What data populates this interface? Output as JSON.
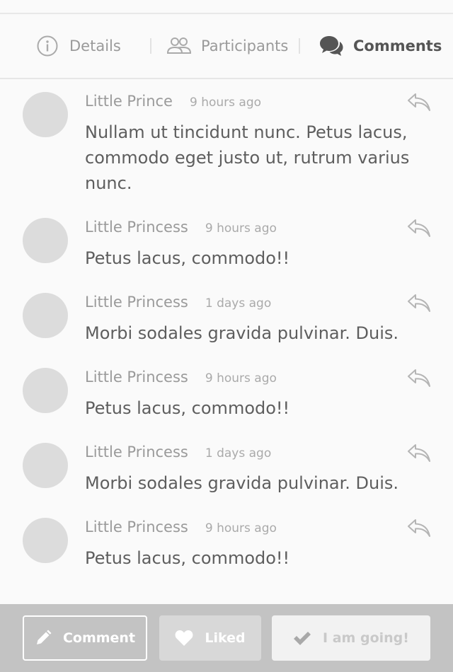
{
  "tabs": [
    {
      "label": "Details",
      "icon": "info-icon",
      "active": false
    },
    {
      "label": "Participants",
      "icon": "people-icon",
      "active": false
    },
    {
      "label": "Comments",
      "icon": "comments-icon",
      "active": true
    }
  ],
  "comments": [
    {
      "author": "Little Prince",
      "time": "9 hours ago",
      "text": "Nullam ut tincidunt nunc. Petus lacus, commodo eget justo ut, rutrum varius nunc."
    },
    {
      "author": "Little Princess",
      "time": "9 hours ago",
      "text": "Petus lacus, commodo!!"
    },
    {
      "author": "Little Princess",
      "time": "1 days ago",
      "text": "Morbi sodales gravida pulvinar. Duis."
    },
    {
      "author": "Little Princess",
      "time": "9 hours ago",
      "text": "Petus lacus, commodo!!"
    },
    {
      "author": "Little Princess",
      "time": "1 days ago",
      "text": "Morbi sodales gravida pulvinar. Duis."
    },
    {
      "author": "Little Princess",
      "time": "9 hours ago",
      "text": "Petus lacus, commodo!!"
    }
  ],
  "actions": {
    "comment_label": "Comment",
    "liked_label": "Liked",
    "going_label": "I am going!"
  },
  "colors": {
    "background": "#fafafa",
    "footer": "#c3c3c3",
    "avatar": "#dcdcdc",
    "active_tab": "#555555",
    "inactive_tab": "#9a9a9a"
  }
}
